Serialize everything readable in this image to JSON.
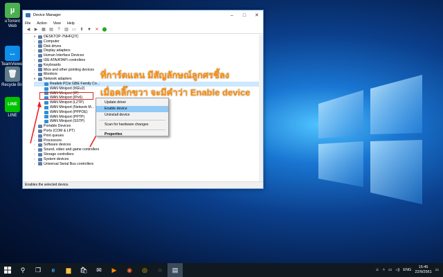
{
  "desktop": {
    "icons": [
      {
        "label": "uTorrent Web",
        "glyph": "µ",
        "color": "#4caf50"
      },
      {
        "label": "TeamViewer 13",
        "glyph": "↔",
        "color": "#0e8ee9"
      },
      {
        "label": "Recycle Bin",
        "glyph": "🗑",
        "color": "#607d8b"
      },
      {
        "label": "LINE",
        "glyph": "LINE",
        "color": "#00c300"
      }
    ]
  },
  "window": {
    "title": "Device Manager",
    "menu": [
      "File",
      "Action",
      "View",
      "Help"
    ],
    "computer": "DESKTOP-7NHFQ7C",
    "tree": [
      {
        "label": "Computer",
        "child": false
      },
      {
        "label": "Disk drives",
        "child": false
      },
      {
        "label": "Display adapters",
        "child": false
      },
      {
        "label": "Human Interface Devices",
        "child": false
      },
      {
        "label": "IDE ATA/ATAPI controllers",
        "child": false
      },
      {
        "label": "Keyboards",
        "child": false
      },
      {
        "label": "Mice and other pointing devices",
        "child": false
      },
      {
        "label": "Monitors",
        "child": false
      },
      {
        "label": "Network adapters",
        "child": false,
        "expanded": true
      },
      {
        "label": "Realtek PCIe GBE Family Co...",
        "child": true,
        "selected": true
      },
      {
        "label": "WAN Miniport (IKEv2)",
        "child": true
      },
      {
        "label": "WAN Miniport (IP)",
        "child": true
      },
      {
        "label": "WAN Miniport (IPv6)",
        "child": true
      },
      {
        "label": "WAN Miniport (L2TP)",
        "child": true
      },
      {
        "label": "WAN Miniport (Network M...",
        "child": true
      },
      {
        "label": "WAN Miniport (PPPOE)",
        "child": true
      },
      {
        "label": "WAN Miniport (PPTP)",
        "child": true
      },
      {
        "label": "WAN Miniport (SSTP)",
        "child": true
      },
      {
        "label": "Portable Devices",
        "child": false
      },
      {
        "label": "Ports (COM & LPT)",
        "child": false
      },
      {
        "label": "Print queues",
        "child": false
      },
      {
        "label": "Processors",
        "child": false
      },
      {
        "label": "Software devices",
        "child": false
      },
      {
        "label": "Sound, video and game controllers",
        "child": false
      },
      {
        "label": "Storage controllers",
        "child": false
      },
      {
        "label": "System devices",
        "child": false
      },
      {
        "label": "Universal Serial Bus controllers",
        "child": false
      }
    ],
    "status": "Enables the selected device."
  },
  "context_menu": {
    "items": [
      "Update driver",
      "Enable device",
      "Uninstall device",
      "Scan for hardware changes",
      "Properties"
    ]
  },
  "annotation": {
    "line1": "ที่การ์ดแลน มีสัญลักษณ์ลูกศรชี้ลง",
    "line2": "เมื่อคลิ๊กขวา จะมีคำว่า Enable device"
  },
  "taskbar": {
    "lang": "ENG",
    "time": "15:45",
    "date": "22/9/2561"
  },
  "colors": {
    "annotation": "#ff8c00",
    "highlight": "#e82020",
    "selection": "#cde8ff"
  }
}
